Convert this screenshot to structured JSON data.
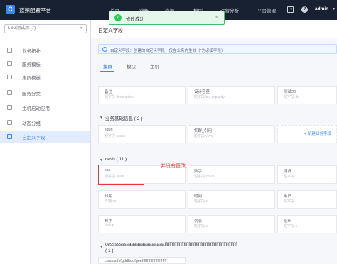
{
  "app": {
    "title": "蓝鲸配置平台",
    "logo": "C"
  },
  "nav": {
    "home": "首页",
    "business": "业务",
    "resource": "资源",
    "model": "模型",
    "ops": "运营分析",
    "platform": "平台管理"
  },
  "user": {
    "name": "admin"
  },
  "toast": {
    "text": "修改成功"
  },
  "sidebar": {
    "business_select": "LSG测试用 (7)",
    "items": [
      "业务拓扑",
      "服务模板",
      "集群模板",
      "服务分类",
      "主机启动应用",
      "动态分组",
      "自定义字段"
    ]
  },
  "page": {
    "title": "自定义字段"
  },
  "notice": {
    "text": "自定义字段：创建的自定义字段，仅在业务内生效（*为必填字段）"
  },
  "tabs": [
    "集群",
    "模块",
    "主机"
  ],
  "top_fields": [
    {
      "label": "备注",
      "key": "短字段  description"
    },
    {
      "label": "设计容量",
      "key": "短字段  bk_capacity"
    },
    {
      "label": "测试22",
      "key": "短字段  dd"
    }
  ],
  "groups": [
    {
      "title": "业务基础信息 ( 2 )"
    },
    {
      "title": "cesh ( 11 )"
    },
    {
      "title": "cessssssssaaaaaaaaaaaaaaffffffffffffffffffffffffffffffffffffffffffffffffffffffffffff"
    },
    {
      "title": "( 1 )"
    }
  ],
  "group1_fields": [
    {
      "label": "jiqun",
      "key": "短字段  sssss"
    },
    {
      "label": "集群_引用",
      "key": "短字段  vvvv"
    }
  ],
  "add_field": "+ 新建业务字段",
  "group2_fields": [
    {
      "label": "sss",
      "key": "短字段  aaaa"
    },
    {
      "label": "数字",
      "key": "短字段  zhusi"
    },
    {
      "label": "浮点",
      "key": "短字段"
    },
    {
      "label": "日期",
      "key": "日期  ss"
    },
    {
      "label": "时间",
      "key": "短字段  s"
    },
    {
      "label": "用户",
      "key": "短字段"
    },
    {
      "label": "布尔",
      "key": "bool  p"
    },
    {
      "label": "列表",
      "key": "短字段  s"
    },
    {
      "label": "组织",
      "key": "短字段  z"
    }
  ],
  "group3_first": "clssssdfsfgddhddfgeeffffffffffffffffffffffff",
  "annotation": {
    "text": "并没有更改"
  },
  "colors": {
    "topbar": "#182132",
    "accent": "#3a84ff",
    "success": "#2dcb56",
    "annotation": "#ea3636"
  }
}
